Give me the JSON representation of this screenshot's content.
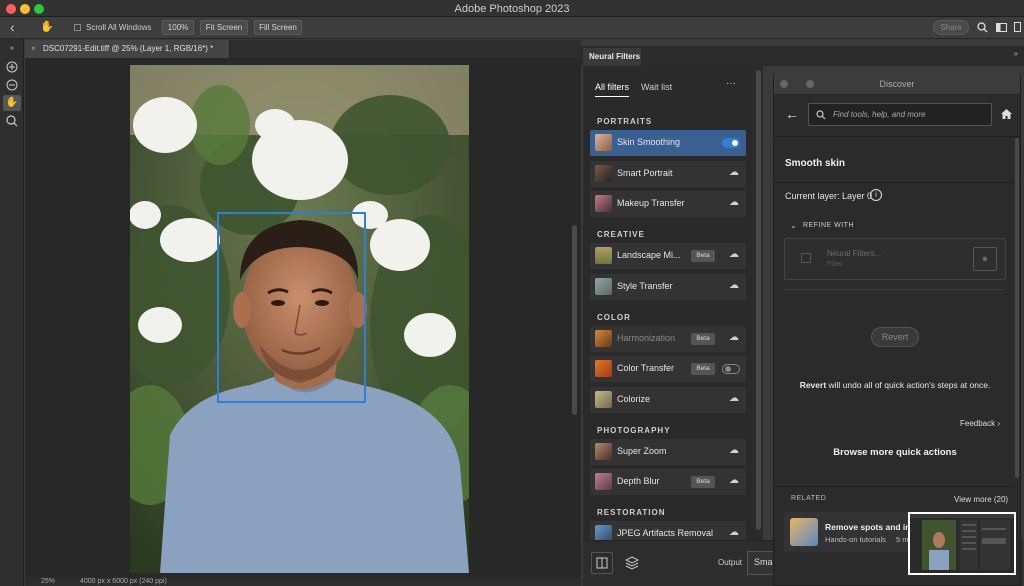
{
  "window": {
    "title": "Adobe Photoshop 2023"
  },
  "colors": {
    "accent": "#2f7fd8",
    "active_row": "#3a5f91",
    "traffic_red": "#ff5f57",
    "traffic_yellow": "#febc2e",
    "traffic_green": "#28c840"
  },
  "options_bar": {
    "scroll_all": "Scroll All Windows",
    "zoom_100": "100%",
    "fit_screen": "Fit Screen",
    "fill_screen": "Fill Screen",
    "share": "Share"
  },
  "document": {
    "tab_title": "DSC07291-Edit.tiff @ 25% (Layer 1, RGB/16*) *"
  },
  "status": {
    "zoom": "25%",
    "dimensions": "4000 px x 6000 px (240 ppi)"
  },
  "neural_filters": {
    "panel_title": "Neural Filters",
    "tabs": {
      "all": "All filters",
      "wait": "Wait list"
    },
    "more": "···",
    "sections": {
      "portraits": "PORTRAITS",
      "creative": "CREATIVE",
      "color": "COLOR",
      "photography": "PHOTOGRAPHY",
      "restoration": "RESTORATION"
    },
    "filters": {
      "skin_smoothing": "Skin Smoothing",
      "smart_portrait": "Smart Portrait",
      "makeup_transfer": "Makeup Transfer",
      "landscape_mixer": "Landscape Mi...",
      "style_transfer": "Style Transfer",
      "harmonization": "Harmonization",
      "color_transfer": "Color Transfer",
      "colorize": "Colorize",
      "super_zoom": "Super Zoom",
      "depth_blur": "Depth Blur",
      "jpeg_artifacts": "JPEG Artifacts Removal"
    },
    "beta": "Beta",
    "output_label": "Output",
    "output_value": "Smar"
  },
  "discover": {
    "title": "Discover",
    "search_placeholder": "Find tools, help, and more",
    "heading": "Smooth skin",
    "current_layer": "Current layer: Layer 0",
    "refine_with": "REFINE WITH",
    "refine_item": "Neural Filters...",
    "refine_sub": "Filter",
    "revert": "Revert",
    "revert_desc_bold": "Revert",
    "revert_desc": " will undo all of quick action's steps at once.",
    "feedback": "Feedback",
    "browse_more": "Browse more quick actions",
    "related": "RELATED",
    "view_more": "View more (20)",
    "related_title": "Remove spots and imp",
    "related_sub": "Hands-on tutorials",
    "related_time": "5 m"
  }
}
